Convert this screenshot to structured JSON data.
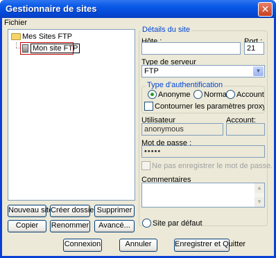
{
  "window": {
    "title": "Gestionnaire de sites",
    "close_icon": "close-icon"
  },
  "menu": {
    "fichier_label": "Fichier"
  },
  "tree": {
    "root_label": "Mes Sites FTP",
    "child_label": "Mon site FTP"
  },
  "left_buttons": {
    "nouveau_site": "Nouveau site",
    "creer_dossier": "Créer dossier",
    "supprimer": "Supprimer",
    "copier": "Copier",
    "renommer": "Renommer",
    "avance": "Avancé..."
  },
  "details": {
    "legend": "Détails du site",
    "hote_label": "Hôte :",
    "hote_value": "",
    "port_label": "Port :",
    "port_value": "21",
    "server_type_label": "Type de serveur",
    "server_type_value": "FTP"
  },
  "auth": {
    "legend": "Type d'authentification",
    "options": [
      "Anonyme",
      "Normal",
      "Account"
    ],
    "selected": "Anonyme",
    "bypass_proxy_label": "Contourner les paramètres proxy / pare-feu"
  },
  "credentials": {
    "user_label": "Utilisateur",
    "user_value": "anonymous",
    "account_label": "Account:",
    "account_value": "",
    "password_label": "Mot de passe :",
    "password_value": "•••••",
    "save_password_label": "Ne pas enregistrer le mot de passe."
  },
  "comments": {
    "label": "Commentaires",
    "value": ""
  },
  "default_site_label": "Site par défaut",
  "bottom_buttons": {
    "connexion": "Connexion",
    "annuler": "Annuler",
    "save_quit": "Enregistrer et Quitter"
  },
  "colors": {
    "titlebar": "#0a5ae8",
    "legend": "#0046d5",
    "dialog_bg": "#ece9d8"
  }
}
